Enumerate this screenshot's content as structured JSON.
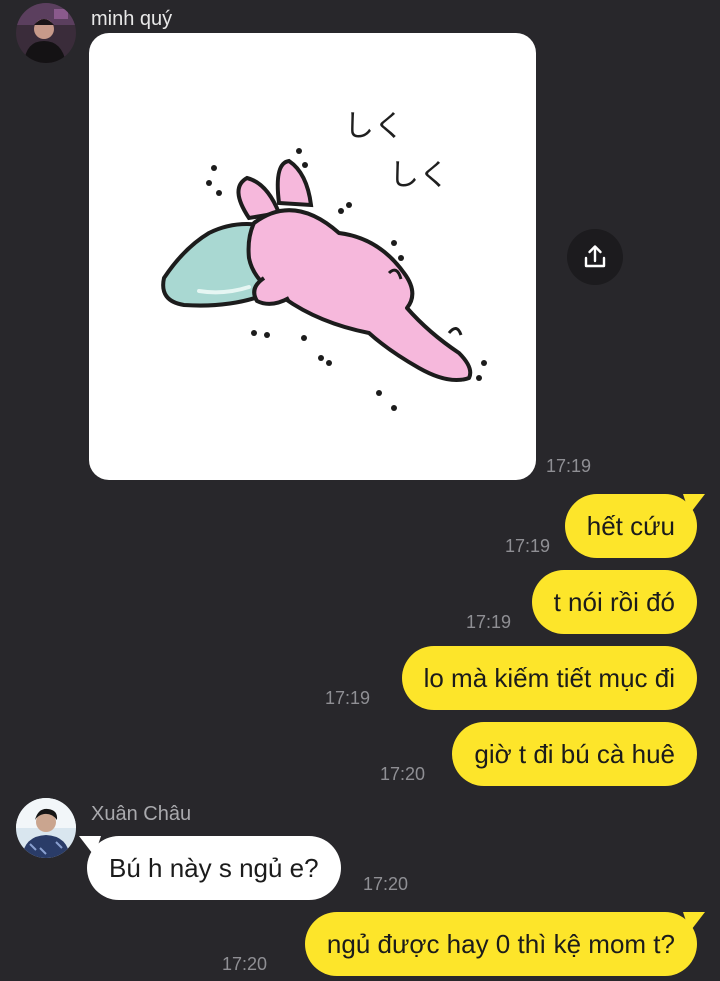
{
  "messages": [
    {
      "sender": "minh quý",
      "type": "sticker",
      "sticker_text_1": "しく",
      "sticker_text_2": "しく",
      "time": "17:19"
    },
    {
      "direction": "outgoing",
      "text": "hết cứu",
      "time": "17:19"
    },
    {
      "direction": "outgoing",
      "text": "t nói rồi đó",
      "time": "17:19"
    },
    {
      "direction": "outgoing",
      "text": "lo mà kiếm tiết mục đi",
      "time": "17:19"
    },
    {
      "direction": "outgoing",
      "text": "giờ t đi bú cà huê",
      "time": "17:20"
    },
    {
      "sender": "Xuân Châu",
      "direction": "incoming",
      "text": "Bú h này s ngủ e?",
      "time": "17:20"
    },
    {
      "direction": "outgoing",
      "text": "ngủ được hay 0 thì kệ mom t?",
      "time": "17:20"
    }
  ],
  "icons": {
    "share": "share-icon"
  },
  "colors": {
    "background": "#28272b",
    "outgoing_bubble": "#fde52a",
    "incoming_bubble": "#ffffff",
    "timestamp": "#8f8f94"
  }
}
